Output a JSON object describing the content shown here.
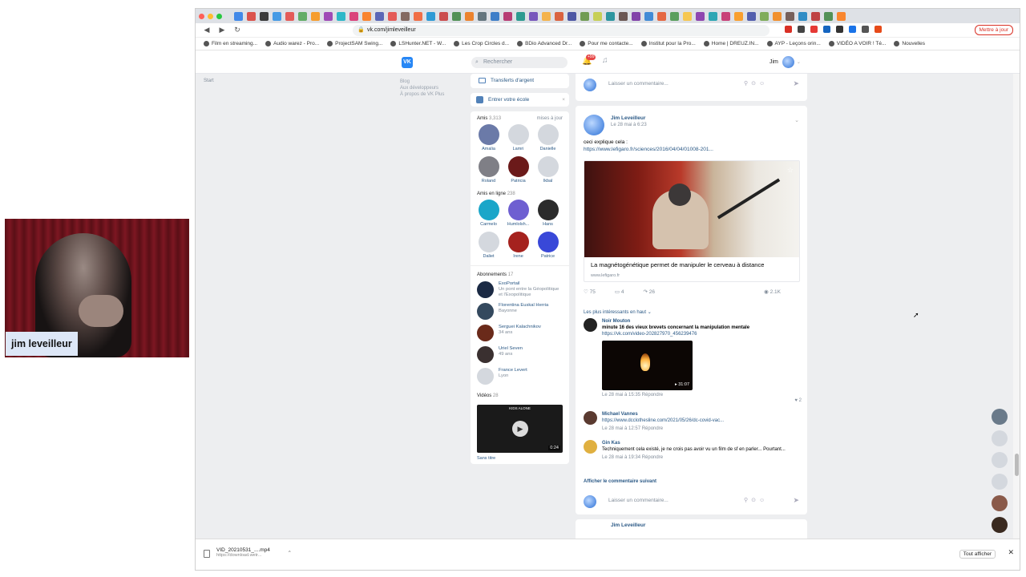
{
  "browser": {
    "url": "vk.com/jimleveilleur",
    "bookmarks": [
      "Film en streaming...",
      "Audio warez - Pro...",
      "ProjectSAM Swing...",
      "LSHunter.NET - W...",
      "Les Crop Circles d...",
      "BDio Advanced Dr...",
      "Pour me contacte...",
      "Institut pour la Pro...",
      "Home | DREUZ.IN...",
      "AYP - Leçons orin...",
      "VIDÉO A VOIR ! Té...",
      "Nouvelles"
    ],
    "update_button": "Mettre à jour",
    "tab_colors": [
      "#1a73e8",
      "#d93025",
      "#111111",
      "#1e88e5",
      "#e53935",
      "#43a047",
      "#fb8c00",
      "#8e24aa",
      "#00acc1",
      "#d81b60",
      "#ff6d00",
      "#3949ab",
      "#e53935",
      "#6d4c41",
      "#f4511e",
      "#0288d1",
      "#c62828",
      "#2e7d32",
      "#ef6c00",
      "#455a64",
      "#1565c0",
      "#ad1457",
      "#00897b",
      "#5e35b1",
      "#f9a825",
      "#d84315",
      "#283593",
      "#558b2f",
      "#c0ca33",
      "#00838f",
      "#4e342e",
      "#6a1b9a",
      "#1976d2",
      "#e64a19",
      "#388e3c",
      "#fbc02d",
      "#7b1fa2",
      "#0097a7",
      "#c2185b",
      "#ff8f00",
      "#303f9f",
      "#689f38",
      "#f57c00",
      "#5d4037",
      "#0277bd",
      "#b71c1c",
      "#2e7d32",
      "#ff6f00"
    ]
  },
  "vk": {
    "logo": "VK",
    "search_placeholder": "Rechercher",
    "notif_count": "+99",
    "user_name": "Jim",
    "left_menu": [
      "Blog",
      "Aux développeurs",
      "À propos de VK   Plus"
    ],
    "mini_ad": "Start",
    "transfer_label": "Transferts d'argent",
    "school_label": "Entrer votre école",
    "friends_title": "Amis",
    "friends_count": "3,313",
    "friends_action": "mises à jour",
    "friends": [
      {
        "name": "Amalia",
        "color": "#6b7aa8"
      },
      {
        "name": "Lamri",
        "color": "#d4d8de"
      },
      {
        "name": "Danielle",
        "color": "#d4d8de"
      },
      {
        "name": "Roland",
        "color": "#7f7f86"
      },
      {
        "name": "Patricia",
        "color": "#6b1a1a"
      },
      {
        "name": "Ikbal",
        "color": "#d4d8de"
      }
    ],
    "online_title": "Amis en ligne",
    "online_count": "238",
    "online_friends": [
      {
        "name": "Carmelo",
        "color": "#1aa6c9"
      },
      {
        "name": "Humlolsh...",
        "color": "#6e5fd1"
      },
      {
        "name": "Hans",
        "color": "#2b2b2b"
      },
      {
        "name": "Daliet",
        "color": "#d4d8de"
      },
      {
        "name": "Irene",
        "color": "#a5221e"
      },
      {
        "name": "Patrice",
        "color": "#3948d8"
      }
    ],
    "subs_title": "Abonnements",
    "subs_count": "17",
    "subscriptions": [
      {
        "name": "ExoPortail",
        "desc": "Un pont entre la Géopolitique et l'Exopolitique",
        "color": "#1b2a44"
      },
      {
        "name": "Florentina Euskal Herria",
        "desc": "Bayonne",
        "color": "#34495e"
      },
      {
        "name": "Serguei Kalachnikov",
        "desc": "34 ans",
        "color": "#6a2a1a"
      },
      {
        "name": "Uriel Seven",
        "desc": "49 ans",
        "color": "#3a3030"
      },
      {
        "name": "France Levert",
        "desc": "Lyon",
        "color": "#d4d8de"
      }
    ],
    "videos_title": "Vidéos",
    "videos_count": "28",
    "video": {
      "duration": "0:24",
      "caption": "Sans titre",
      "tag": "KIDS ALONE"
    }
  },
  "feed": {
    "comment_placeholder": "Laisser un commentaire...",
    "post": {
      "author": "Jim Leveilleur",
      "date": "Le 28 mai à 6:23",
      "text": "ceci explique cela :",
      "link": "https://www.lefigaro.fr/sciences/2016/04/04/01008-201...",
      "link_title": "La magnétogénétique permet de manipuler le cerveau à distance",
      "link_domain": "www.lefigaro.fr",
      "likes": "75",
      "comments": "4",
      "shares": "26",
      "views": "2.1K"
    },
    "interesting_label": "Les plus intéressants en haut",
    "comments": [
      {
        "author": "Noir Mouton",
        "text": "minute 16 des vieux brevets concernant la manipulation mentale",
        "link": "https://vk.com/video-202827970_456239476",
        "video_duration": "31:07",
        "meta": "Le 28 mai à 15:35   Répondre",
        "likes": "2",
        "color": "#222"
      },
      {
        "author": "Michael Vannes",
        "text": "",
        "link": "https://www.dcclothesline.com/2021/05/26/dc-covid-vac...",
        "meta": "Le 28 mai à 12:57   Répondre",
        "color": "#5a3a30"
      },
      {
        "author": "Gin Kas",
        "text": "Techniquement cela existé, je ne crois pas avoir vu un film de sf en parler... Pourtant...",
        "link": "",
        "meta": "Le 28 mai à 19:34   Répondre",
        "color": "#e0b040"
      }
    ],
    "show_next": "Afficher le commentaire suivant",
    "next_author": "Jim Leveilleur"
  },
  "right_rail": [
    "#6a7a8a",
    "#d4d8de",
    "#d4d8de",
    "#d4d8de",
    "#8a5a4a",
    "#3a2a20"
  ],
  "downloads": {
    "file": "VID_20210531_....mp4",
    "url": "https://download.wetr...",
    "show_all": "Tout afficher"
  },
  "webcam": {
    "label": "jim leveilleur"
  }
}
